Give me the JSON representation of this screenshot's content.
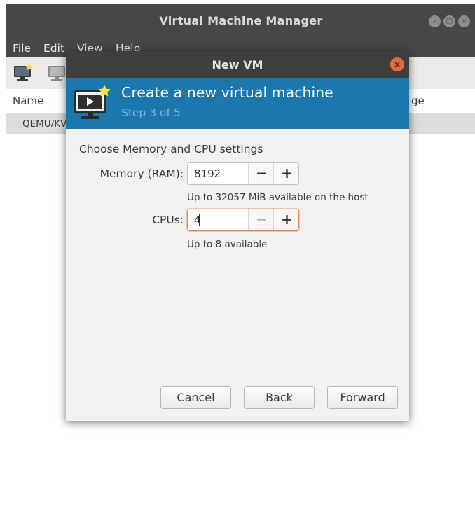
{
  "main_window": {
    "title": "Virtual Machine Manager",
    "menu": [
      "File",
      "Edit",
      "View",
      "Help"
    ],
    "columns": {
      "name": "Name",
      "usage_partial": "ge"
    },
    "connection_row_partial": "QEMU/KV"
  },
  "dialog": {
    "title": "New VM",
    "heading": "Create a new virtual machine",
    "step": "Step 3 of 5",
    "section_title": "Choose Memory and CPU settings",
    "memory": {
      "label": "Memory (RAM):",
      "value": "8192",
      "hint": "Up to 32057 MiB available on the host"
    },
    "cpus": {
      "label": "CPUs:",
      "value": "4",
      "hint": "Up to 8 available"
    },
    "spin_minus": "−",
    "spin_plus": "+",
    "buttons": {
      "cancel": "Cancel",
      "back": "Back",
      "forward": "Forward"
    }
  },
  "colors": {
    "header_blue": "#1c77ad",
    "step_text": "#7ab8e0",
    "close_orange": "#e96a38",
    "focus_border": "#e48a5f"
  },
  "icons": {
    "toolbar_new_vm": "monitor-star-icon",
    "toolbar_open": "monitor-icon",
    "header": "monitor-play-star-icon"
  }
}
